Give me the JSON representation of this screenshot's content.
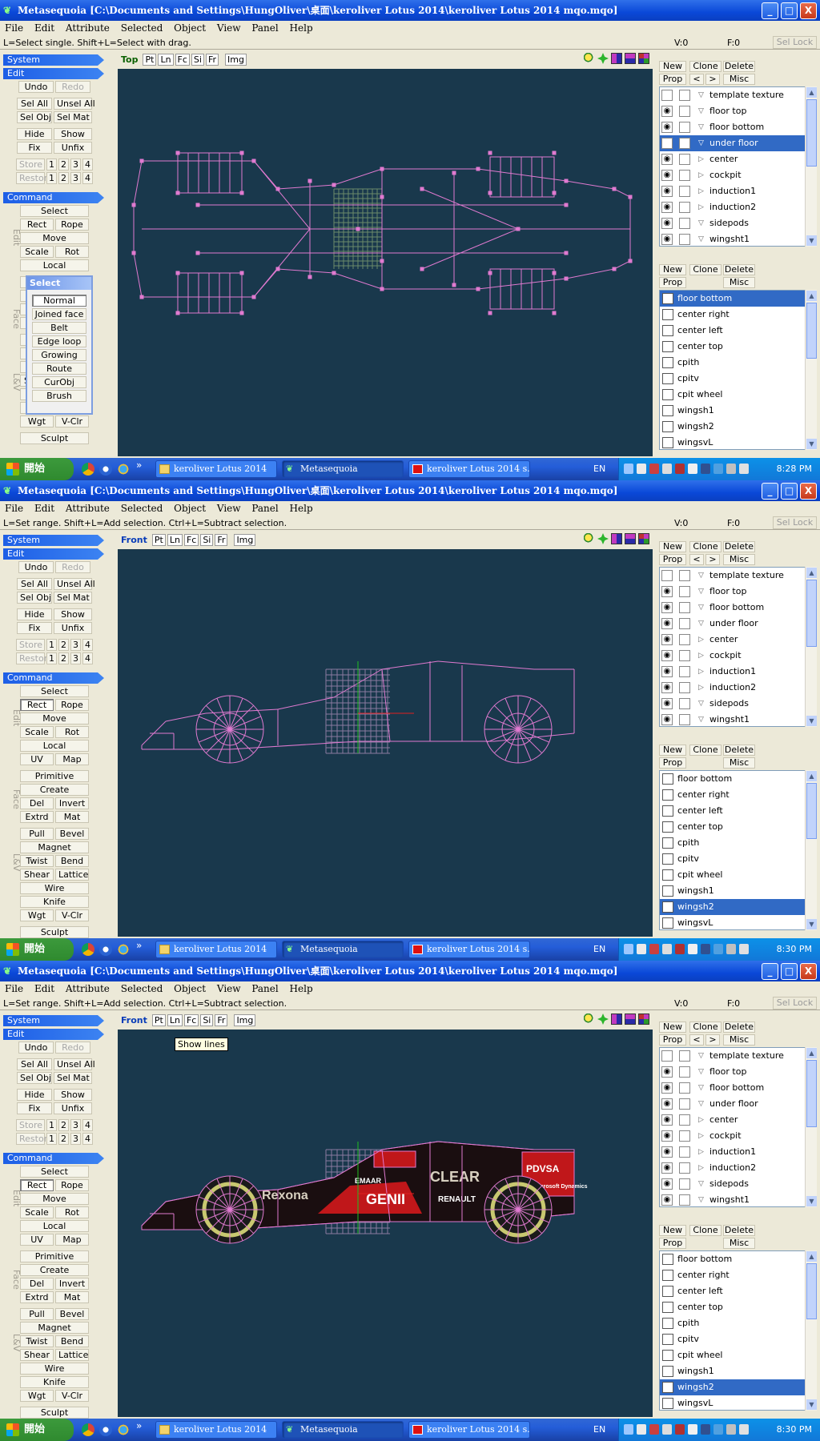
{
  "window": {
    "title": "Metasequoia [C:\\Documents and Settings\\HungOliver\\桌面\\keroliver Lotus 2014\\keroliver Lotus 2014 mqo.mqo]",
    "min_label": "_",
    "max_label": "□",
    "close_label": "X"
  },
  "menu": [
    "File",
    "Edit",
    "Attribute",
    "Selected",
    "Object",
    "View",
    "Panel",
    "Help"
  ],
  "status": {
    "v_count": "V:0",
    "f_count": "F:0",
    "sel_lock": "Sel Lock"
  },
  "panels": [
    {
      "hint": "L=Select single.  Shift+L=Select with drag.",
      "view_name": "Top",
      "time": "8:28 PM"
    },
    {
      "hint": "L=Set range.  Shift+L=Add selection.  Ctrl+L=Subtract selection.",
      "view_name": "Front",
      "time": "8:30 PM"
    },
    {
      "hint": "L=Set range.  Shift+L=Add selection.  Ctrl+L=Subtract selection.",
      "view_name": "Front",
      "time": "8:30 PM",
      "tooltip": "Show lines"
    }
  ],
  "left": {
    "system": "System",
    "edit": "Edit",
    "undo": "Undo",
    "redo": "Redo",
    "sel_all": "Sel All",
    "unsel_all": "Unsel All",
    "sel_obj": "Sel Obj",
    "sel_mat": "Sel Mat",
    "hide": "Hide",
    "show": "Show",
    "fix": "Fix",
    "unfix": "Unfix",
    "store": "Store",
    "restore": "Restore",
    "n1": "1",
    "n2": "2",
    "n3": "3",
    "n4": "4",
    "command": "Command",
    "select": "Select",
    "rect": "Rect",
    "rope": "Rope",
    "move": "Move",
    "scale": "Scale",
    "rot": "Rot",
    "local": "Local",
    "uv": "UV",
    "map": "Map",
    "primitive": "Primitive",
    "create": "Create",
    "del": "Del",
    "invert": "Invert",
    "extrd": "Extrd",
    "mat": "Mat",
    "pull": "Pull",
    "bevel": "Bevel",
    "magnet": "Magnet",
    "twist": "Twist",
    "bend": "Bend",
    "shear": "Shear",
    "lattice": "Lattice",
    "wire": "Wire",
    "knife": "Knife",
    "wgt": "Wgt",
    "vclr": "V-Clr",
    "sculpt": "Sculpt",
    "side_edit": "Edit",
    "side_face": "Face",
    "side_lv": "L&V"
  },
  "select_popup": {
    "title": "Select",
    "items": [
      "Normal",
      "Joined face",
      "Belt",
      "Edge loop",
      "Growing",
      "Route",
      "CurObj",
      "Brush"
    ]
  },
  "viewbar": {
    "pt": "Pt",
    "ln": "Ln",
    "fc": "Fc",
    "si": "Si",
    "fr": "Fr",
    "img": "Img"
  },
  "objpanel": {
    "new": "New",
    "clone": "Clone",
    "delete": "Delete",
    "prop": "Prop",
    "lt": "<",
    "gt": ">",
    "misc": "Misc"
  },
  "objects": [
    "template texture",
    "floor top",
    "floor bottom",
    "under floor",
    "center",
    "cockpit",
    "induction1",
    "induction2",
    "sidepods",
    "wingsht1"
  ],
  "materials": [
    "floor bottom",
    "center right",
    "center left",
    "center top",
    "cpith",
    "cpitv",
    "cpit wheel",
    "wingsh1",
    "wingsh2",
    "wingsvL"
  ],
  "car_text": {
    "sponsor1": "Rexona",
    "sponsor2": "GENII",
    "sponsor3": "CLEAR",
    "sponsor4": "PDVSA",
    "sponsor5": "RENAULT",
    "sponsor6": "EMAAR",
    "sponsor7": "Microsoft Dynamics"
  },
  "taskbar": {
    "start": "開始",
    "tasks": [
      "keroliver Lotus 2014",
      "Metasequoia",
      "keroliver Lotus 2014 s..."
    ],
    "lang": "EN",
    "chevron": "»"
  }
}
